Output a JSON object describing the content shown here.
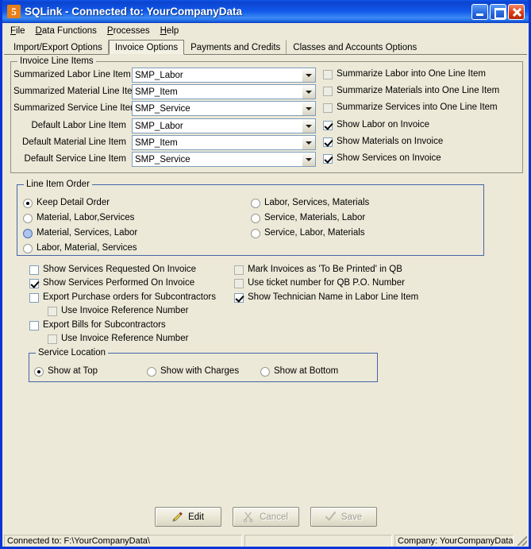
{
  "window": {
    "title": "SQLink - Connected to: YourCompanyData",
    "app_icon": "sqlink-logo-icon",
    "icon_glyph": "5",
    "minimize_label": "Minimize",
    "maximize_label": "Maximize",
    "close_label": "Close",
    "title_bar_color": "#0A46D6",
    "body_color": "#ECE9D8"
  },
  "menu": {
    "items": [
      {
        "label": "File",
        "mnemonic": "F"
      },
      {
        "label": "Data Functions",
        "mnemonic": "D"
      },
      {
        "label": "Processes",
        "mnemonic": "P"
      },
      {
        "label": "Help",
        "mnemonic": "H"
      }
    ]
  },
  "tabs": {
    "selected": "Invoice Options",
    "items": [
      {
        "label": "Import/Export Options",
        "selected": false
      },
      {
        "label": "Invoice Options",
        "selected": true
      },
      {
        "label": "Payments and Credits",
        "selected": false
      },
      {
        "label": "Classes and Accounts Options",
        "selected": false
      }
    ]
  },
  "invoice_line_items": {
    "group_title": "Invoice Line Items",
    "fields": [
      {
        "label": "Summarized Labor Line Item",
        "value": "SMP_Labor"
      },
      {
        "label": "Summarized Material Line Item",
        "value": "SMP_Item"
      },
      {
        "label": "Summarized Service Line Item",
        "value": "SMP_Service"
      },
      {
        "label": "Default Labor Line Item",
        "value": "SMP_Labor"
      },
      {
        "label": "Default Material Line Item",
        "value": "SMP_Item"
      },
      {
        "label": "Default Service Line Item",
        "value": "SMP_Service"
      }
    ],
    "checkboxes": [
      {
        "label": "Summarize Labor into One Line Item",
        "checked": false,
        "disabled": true
      },
      {
        "label": "Summarize Materials into One Line Item",
        "checked": false,
        "disabled": true
      },
      {
        "label": "Summarize Services into One Line Item",
        "checked": false,
        "disabled": true
      },
      {
        "label": "Show Labor on Invoice",
        "checked": true,
        "disabled": false
      },
      {
        "label": "Show Materials on Invoice",
        "checked": true,
        "disabled": false
      },
      {
        "label": "Show Services on Invoice",
        "checked": true,
        "disabled": false
      }
    ]
  },
  "line_item_order": {
    "group_title": "Line Item Order",
    "left_options": [
      {
        "label": "Keep Detail Order",
        "selected": true,
        "hover": false
      },
      {
        "label": "Material, Labor,Services",
        "selected": false,
        "hover": false
      },
      {
        "label": "Material, Services, Labor",
        "selected": false,
        "hover": true
      },
      {
        "label": "Labor, Material, Services",
        "selected": false,
        "hover": false
      }
    ],
    "right_options": [
      {
        "label": "Labor, Services, Materials",
        "selected": false,
        "hover": false
      },
      {
        "label": "Service, Materials, Labor",
        "selected": false,
        "hover": false
      },
      {
        "label": "Service, Labor, Materials",
        "selected": false,
        "hover": false
      }
    ]
  },
  "options": {
    "left": [
      {
        "label": "Show Services Requested On Invoice",
        "checked": false,
        "disabled": false,
        "indent": false
      },
      {
        "label": "Show Services Performed On Invoice",
        "checked": true,
        "disabled": false,
        "indent": false
      },
      {
        "label": "Export Purchase orders for Subcontractors",
        "checked": false,
        "disabled": false,
        "indent": false
      },
      {
        "label": "Use Invoice Reference Number",
        "checked": false,
        "disabled": true,
        "indent": true
      },
      {
        "label": "Export Bills for Subcontractors",
        "checked": false,
        "disabled": false,
        "indent": false
      },
      {
        "label": "Use Invoice Reference Number",
        "checked": false,
        "disabled": true,
        "indent": true
      }
    ],
    "right": [
      {
        "label": "Mark Invoices as 'To Be Printed' in QB",
        "checked": false,
        "disabled": true
      },
      {
        "label": "Use ticket number for QB P.O. Number",
        "checked": false,
        "disabled": true
      },
      {
        "label": "Show Technician Name in Labor Line Item",
        "checked": true,
        "disabled": false
      }
    ]
  },
  "service_location": {
    "group_title": "Service Location",
    "options": [
      {
        "label": "Show at Top",
        "selected": true
      },
      {
        "label": "Show with Charges",
        "selected": false
      },
      {
        "label": "Show at Bottom",
        "selected": false
      }
    ]
  },
  "buttons": [
    {
      "label": "Edit",
      "icon": "pencil-icon",
      "disabled": false
    },
    {
      "label": "Cancel",
      "icon": "scissors-icon",
      "disabled": true
    },
    {
      "label": "Save",
      "icon": "checkmark-icon",
      "disabled": true
    }
  ],
  "statusbar": {
    "connected": "Connected to: F:\\YourCompanyData\\",
    "middle": "",
    "company": "Company: YourCompanyData"
  }
}
